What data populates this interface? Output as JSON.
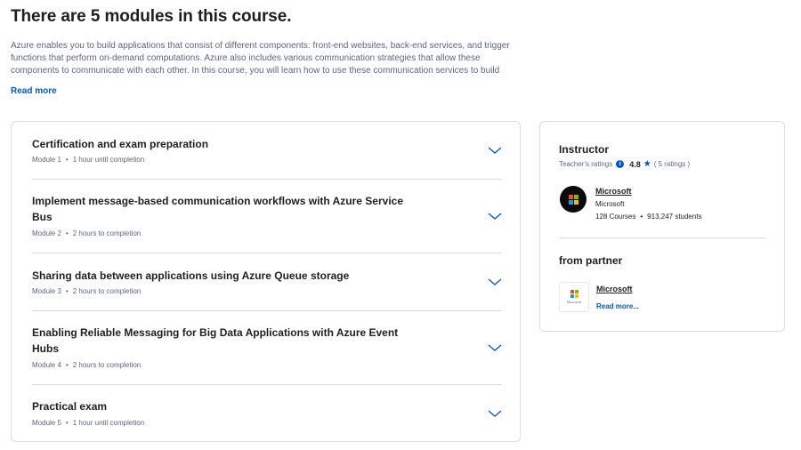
{
  "heading": "There are 5 modules in this course.",
  "description": "Azure enables you to build applications that consist of different components: front-end websites, back-end services, and trigger functions that perform on-demand computations. Azure also includes various communication strategies that allow these components to communicate with each other. In this course, you will learn how to use these communication services to build scalable, efficient",
  "read_more_label": "Read more",
  "modules": [
    {
      "title": "Certification and exam preparation",
      "module_label": "Module 1",
      "duration": "1 hour until completion",
      "icon": "chevron-down-icon"
    },
    {
      "title": "Implement message-based communication workflows with Azure Service Bus",
      "module_label": "Module 2",
      "duration": "2 hours to completion",
      "icon": "chevron-down-icon"
    },
    {
      "title": "Sharing data between applications using Azure Queue storage",
      "module_label": "Module 3",
      "duration": "2 hours to completion",
      "icon": "chevron-down-icon"
    },
    {
      "title": "Enabling Reliable Messaging for Big Data Applications with Azure Event Hubs",
      "module_label": "Module 4",
      "duration": "2 hours to completion",
      "icon": "chevron-down-icon"
    },
    {
      "title": "Practical exam",
      "module_label": "Module 5",
      "duration": "1 hour until completion",
      "icon": "chevron-down-icon"
    }
  ],
  "instructor": {
    "section_title": "Instructor",
    "ratings_label": "Teacher's ratings",
    "rating_value": "4.8",
    "ratings_count": "( 5 ratings )",
    "name": "Microsoft",
    "organization": "Microsoft",
    "courses": "128 Courses",
    "students": "913,247 students"
  },
  "partner": {
    "section_title": "from partner",
    "name": "Microsoft",
    "logo_text": "Microsoft",
    "read_more_label": "Read more..."
  },
  "colors": {
    "accent": "#0056d2",
    "text": "#1f1f1f",
    "muted": "#5b6780",
    "border": "#dadce0"
  }
}
